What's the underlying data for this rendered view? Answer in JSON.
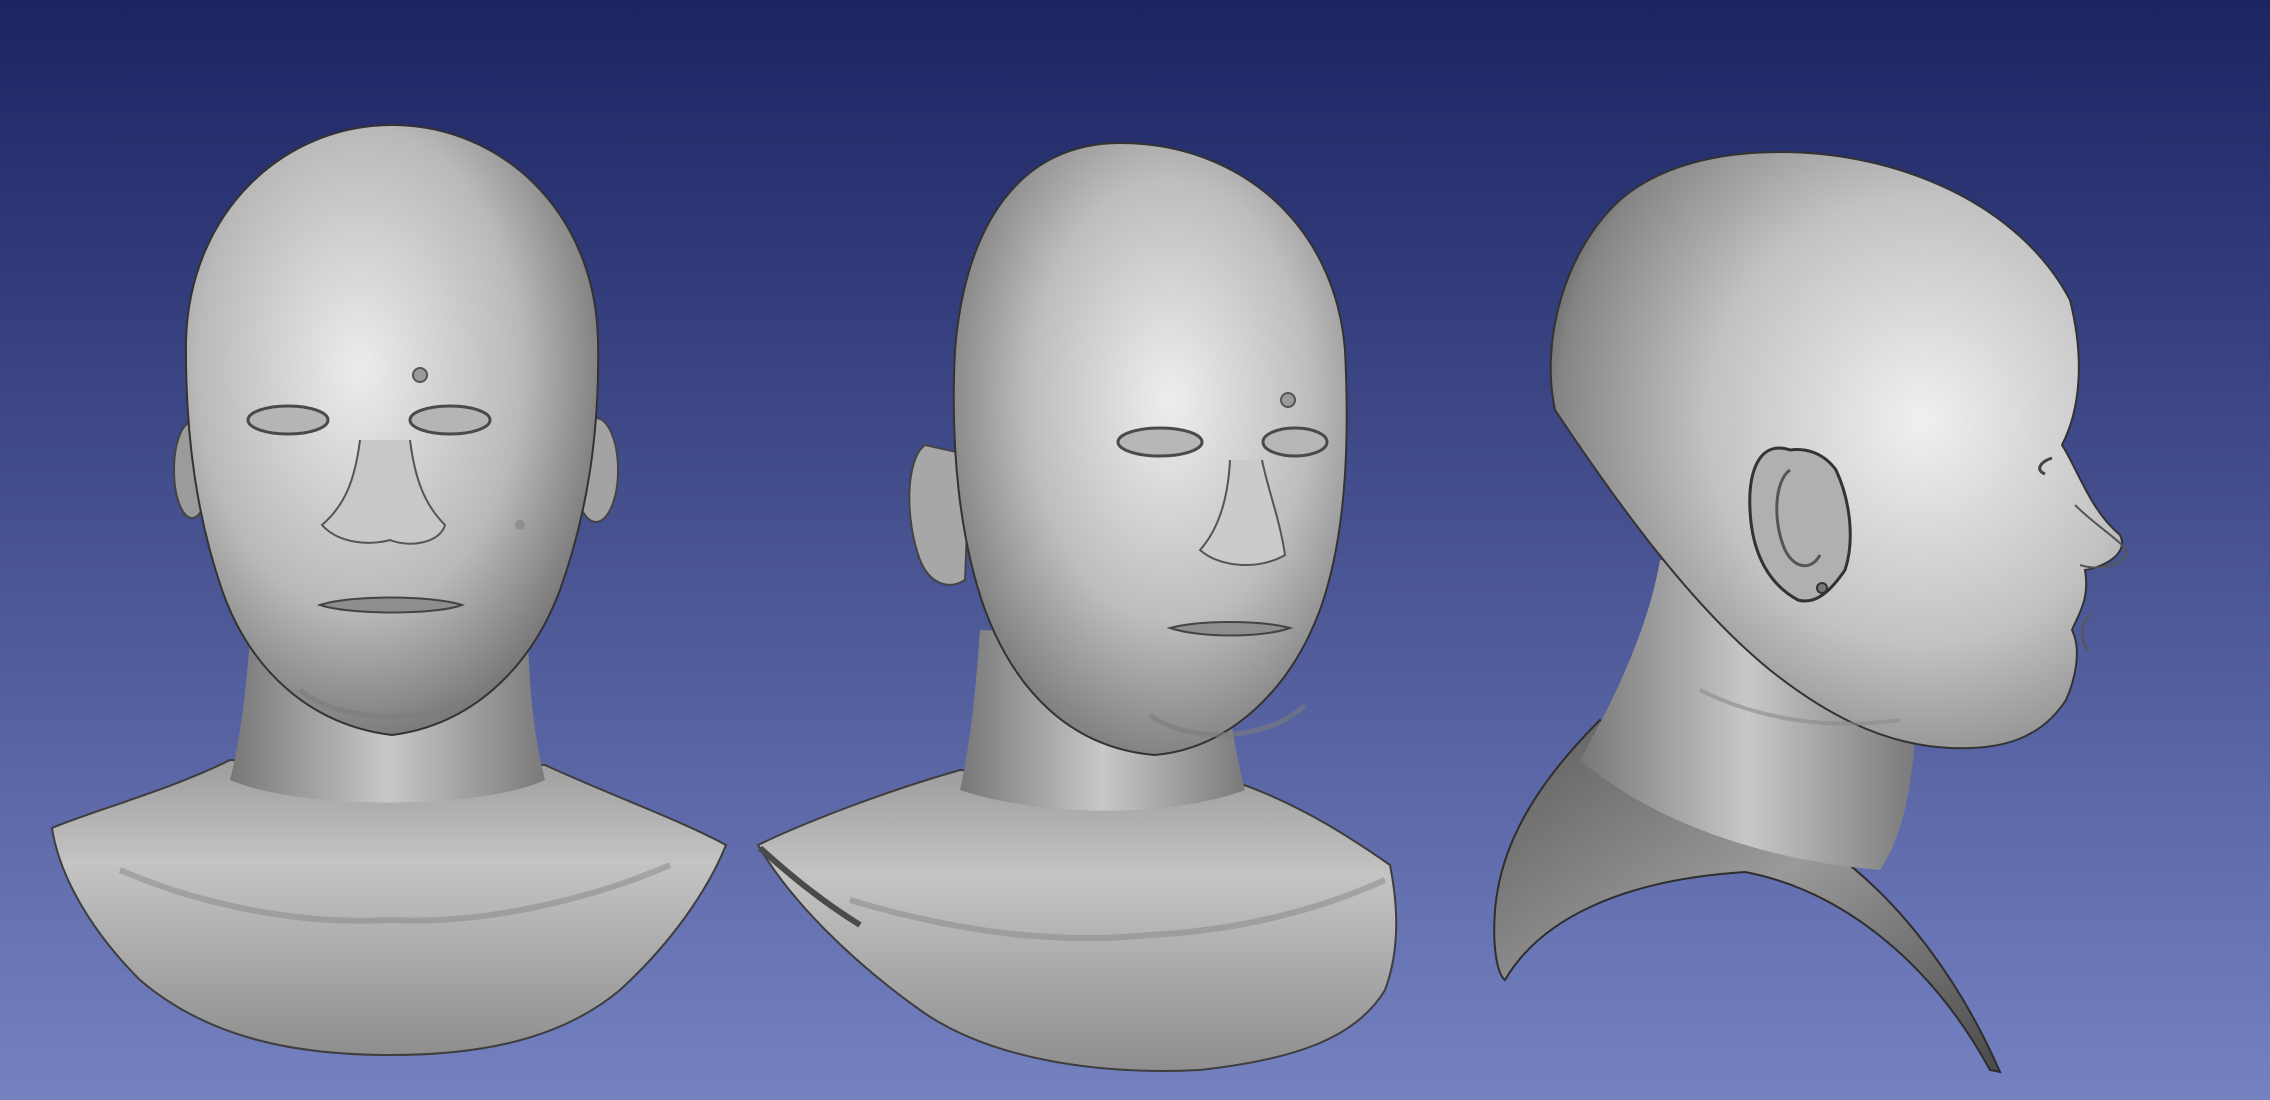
{
  "viewport": {
    "background_top": "#1c2462",
    "background_bottom": "#7582c2",
    "mesh_color": "#a9a9a9",
    "mesh_highlight": "#ececec",
    "mesh_shadow": "#3a3a3a"
  },
  "models": [
    {
      "view": "front"
    },
    {
      "view": "three-quarter"
    },
    {
      "view": "side-profile"
    }
  ]
}
